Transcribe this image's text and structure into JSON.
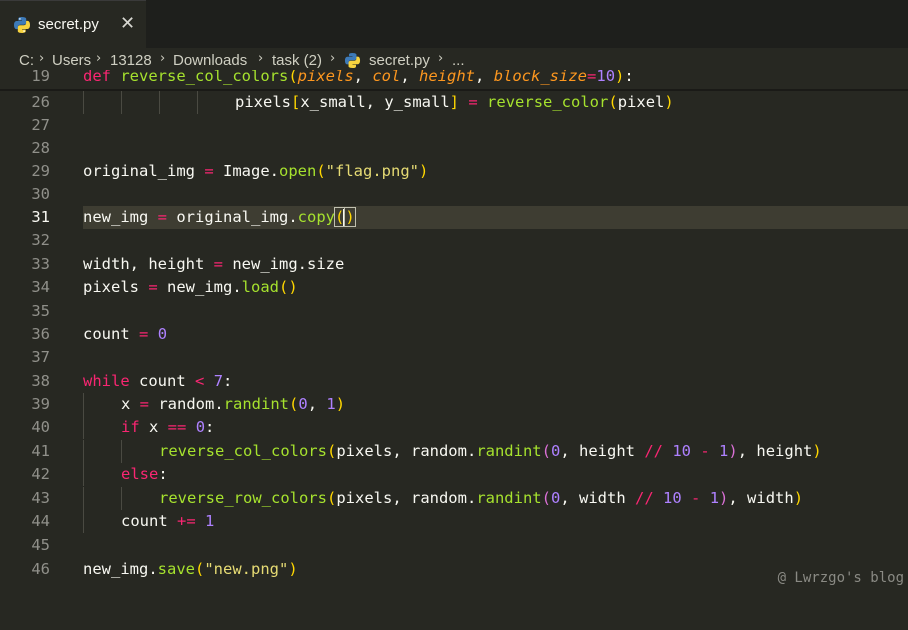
{
  "tab": {
    "filename": "secret.py",
    "close_glyph": "✕",
    "icon": "python-icon"
  },
  "breadcrumb": {
    "items": [
      "C:",
      "Users",
      "13128",
      "Downloads",
      "task (2)",
      "secret.py",
      "..."
    ],
    "separator_glyph": "›"
  },
  "editor": {
    "active_line": "31",
    "lines": [
      {
        "n": "19",
        "text": "def reverse_col_colors(pixels, col, height, block_size=10):"
      },
      {
        "n": "26",
        "text": "pixels[x_small, y_small] = reverse_color(pixel)"
      },
      {
        "n": "27",
        "text": ""
      },
      {
        "n": "28",
        "text": ""
      },
      {
        "n": "29",
        "text": "original_img = Image.open(\"flag.png\")"
      },
      {
        "n": "30",
        "text": ""
      },
      {
        "n": "31",
        "text": "new_img = original_img.copy()"
      },
      {
        "n": "32",
        "text": ""
      },
      {
        "n": "33",
        "text": "width, height = new_img.size"
      },
      {
        "n": "34",
        "text": "pixels = new_img.load()"
      },
      {
        "n": "35",
        "text": ""
      },
      {
        "n": "36",
        "text": "count = 0"
      },
      {
        "n": "37",
        "text": ""
      },
      {
        "n": "38",
        "text": "while count < 7:"
      },
      {
        "n": "39",
        "text": "x = random.randint(0, 1)"
      },
      {
        "n": "40",
        "text": "if x == 0:"
      },
      {
        "n": "41",
        "text": "reverse_col_colors(pixels, random.randint(0, height // 10 - 1), height)"
      },
      {
        "n": "42",
        "text": "else:"
      },
      {
        "n": "43",
        "text": "reverse_row_colors(pixels, random.randint(0, width // 10 - 1), width)"
      },
      {
        "n": "44",
        "text": "count += 1"
      },
      {
        "n": "45",
        "text": ""
      },
      {
        "n": "46",
        "text": "new_img.save(\"new.png\")"
      }
    ]
  },
  "watermark": "@ Lwrzgo's blog",
  "colors": {
    "background": "#272822",
    "tabbar": "#1e1f1c",
    "keyword": "#f92672",
    "number": "#ae81ff",
    "string": "#e6db74",
    "function": "#a6e22e",
    "parameter": "#fd971f"
  }
}
